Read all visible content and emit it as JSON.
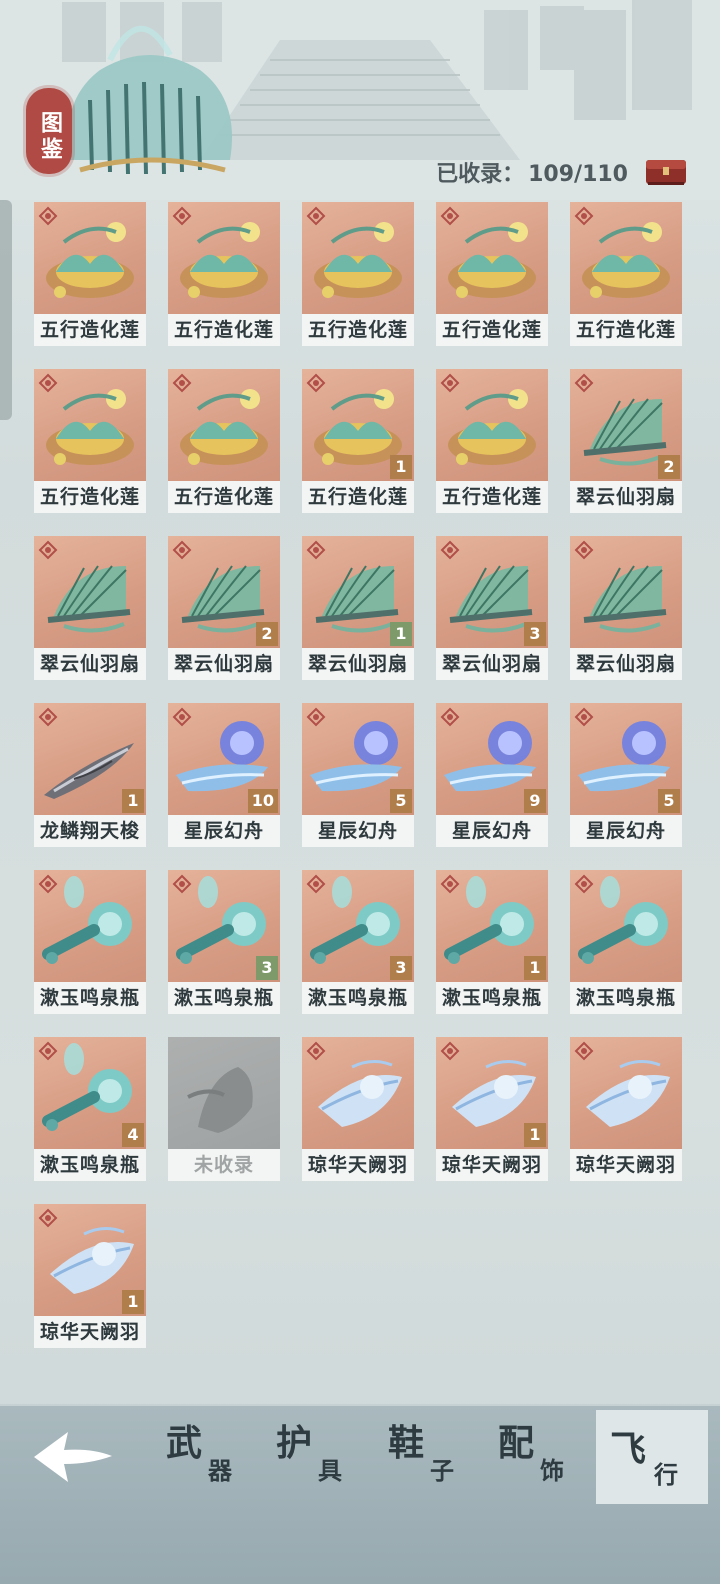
{
  "header": {
    "seal_text": "图鉴",
    "collected_label": "已收录：",
    "collected_value": "109/110"
  },
  "cards": [
    {
      "name": "五行造化莲",
      "art": "lotus",
      "count": ""
    },
    {
      "name": "五行造化莲",
      "art": "lotus",
      "count": ""
    },
    {
      "name": "五行造化莲",
      "art": "lotus",
      "count": ""
    },
    {
      "name": "五行造化莲",
      "art": "lotus",
      "count": ""
    },
    {
      "name": "五行造化莲",
      "art": "lotus",
      "count": ""
    },
    {
      "name": "五行造化莲",
      "art": "lotus",
      "count": ""
    },
    {
      "name": "五行造化莲",
      "art": "lotus",
      "count": ""
    },
    {
      "name": "五行造化莲",
      "art": "lotus",
      "count": "1"
    },
    {
      "name": "五行造化莲",
      "art": "lotus",
      "count": ""
    },
    {
      "name": "翠云仙羽扇",
      "art": "fan",
      "count": "2"
    },
    {
      "name": "翠云仙羽扇",
      "art": "fan",
      "count": ""
    },
    {
      "name": "翠云仙羽扇",
      "art": "fan",
      "count": "2"
    },
    {
      "name": "翠云仙羽扇",
      "art": "fan",
      "count": "1"
    },
    {
      "name": "翠云仙羽扇",
      "art": "fan",
      "count": "3"
    },
    {
      "name": "翠云仙羽扇",
      "art": "fan",
      "count": ""
    },
    {
      "name": "龙鳞翔天梭",
      "art": "shuttle",
      "count": "1"
    },
    {
      "name": "星辰幻舟",
      "art": "boat",
      "count": "10"
    },
    {
      "name": "星辰幻舟",
      "art": "boat",
      "count": "5"
    },
    {
      "name": "星辰幻舟",
      "art": "boat",
      "count": "9"
    },
    {
      "name": "星辰幻舟",
      "art": "boat",
      "count": "5"
    },
    {
      "name": "漱玉鸣泉瓶",
      "art": "bottle",
      "count": ""
    },
    {
      "name": "漱玉鸣泉瓶",
      "art": "bottle",
      "count": "3"
    },
    {
      "name": "漱玉鸣泉瓶",
      "art": "bottle",
      "count": "3"
    },
    {
      "name": "漱玉鸣泉瓶",
      "art": "bottle",
      "count": "1"
    },
    {
      "name": "漱玉鸣泉瓶",
      "art": "bottle",
      "count": ""
    },
    {
      "name": "漱玉鸣泉瓶",
      "art": "bottle",
      "count": "4"
    },
    {
      "name": "未收录",
      "art": "locked",
      "count": ""
    },
    {
      "name": "琼华天阙羽",
      "art": "feather",
      "count": ""
    },
    {
      "name": "琼华天阙羽",
      "art": "feather",
      "count": "1"
    },
    {
      "name": "琼华天阙羽",
      "art": "feather",
      "count": ""
    },
    {
      "name": "琼华天阙羽",
      "art": "feather",
      "count": "1"
    }
  ],
  "tabs": [
    {
      "big": "武",
      "small": "器"
    },
    {
      "big": "护",
      "small": "具"
    },
    {
      "big": "鞋",
      "small": "子"
    },
    {
      "big": "配",
      "small": "饰"
    },
    {
      "big": "飞",
      "small": "行"
    }
  ],
  "icons": {
    "back": "arrow-left-icon",
    "chest": "chest-icon",
    "rank": "rank-emblem-icon"
  },
  "colors": {
    "card_bg": "#d79c84",
    "badge": "#b07e4a",
    "badge_green": "#7e9a6a",
    "seal": "#b04a44"
  }
}
